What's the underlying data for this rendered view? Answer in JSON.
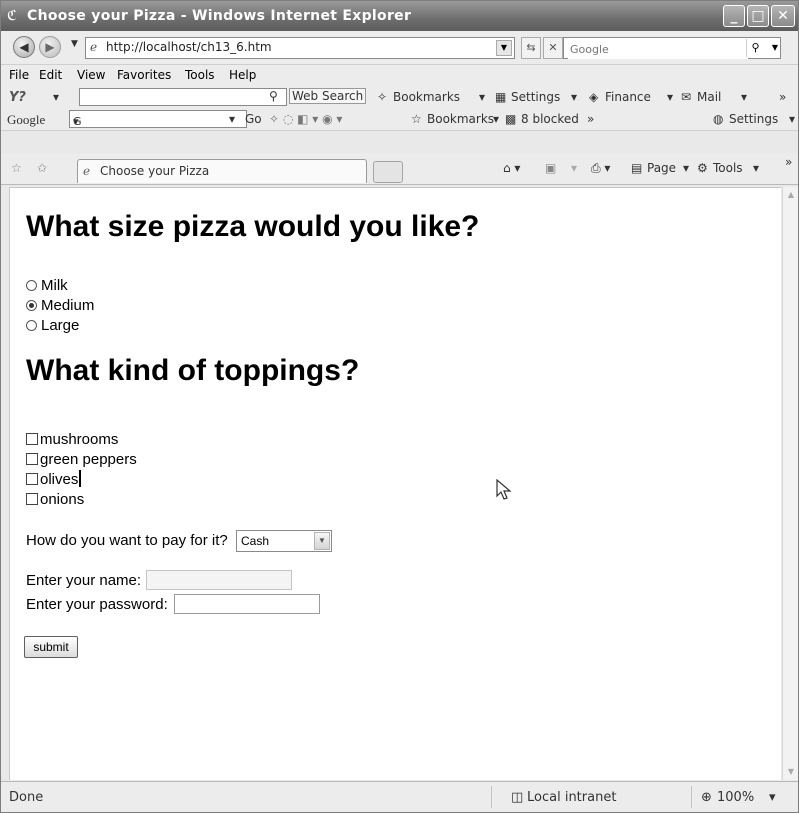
{
  "window": {
    "title": "Choose your Pizza - Windows Internet Explorer",
    "minimize": "_",
    "maximize": "□",
    "close": "✕"
  },
  "address": {
    "url": "http://localhost/ch13_6.htm",
    "search_placeholder": "Google"
  },
  "menu": [
    "File",
    "Edit",
    "View",
    "Favorites",
    "Tools",
    "Help"
  ],
  "yahoo_toolbar": {
    "logo": "Y?",
    "web_search": "Web Search",
    "bookmarks": "Bookmarks",
    "settings": "Settings",
    "finance": "Finance",
    "mail": "Mail"
  },
  "google_toolbar": {
    "logo": "Google",
    "box_value": "G",
    "go": "Go",
    "bookmarks": "Bookmarks",
    "blocked": "8 blocked",
    "settings": "Settings"
  },
  "tabs": {
    "active_tab": "Choose your Pizza",
    "page_menu": "Page",
    "tools_menu": "Tools"
  },
  "form": {
    "heading_size": "What size pizza would you like?",
    "sizes": [
      {
        "label": "Milk",
        "checked": false
      },
      {
        "label": "Medium",
        "checked": true
      },
      {
        "label": "Large",
        "checked": false
      }
    ],
    "heading_toppings": "What kind of toppings?",
    "toppings": [
      {
        "label": "mushrooms",
        "checked": false
      },
      {
        "label": "green peppers",
        "checked": false
      },
      {
        "label": "olives",
        "checked": false
      },
      {
        "label": "onions",
        "checked": false
      }
    ],
    "pay_label": "How do you want to pay for it?",
    "pay_value": "Cash",
    "name_label": "Enter your name:",
    "password_label": "Enter your password:",
    "submit": "submit"
  },
  "status": {
    "text": "Done",
    "zone": "Local intranet",
    "zoom": "100%"
  },
  "colors": {
    "titlebar": "#6e6e6e",
    "chrome": "#ececec"
  }
}
